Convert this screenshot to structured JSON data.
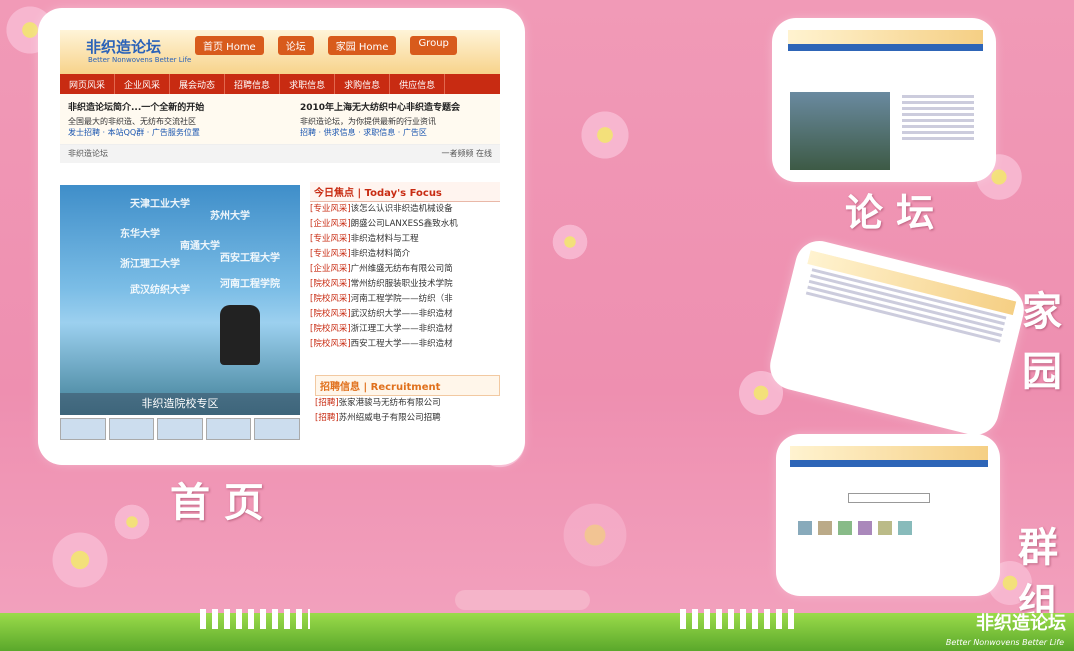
{
  "home": {
    "logo": "非织造论坛",
    "logo_sub": "Better Nonwovens Better Life",
    "top_tabs": [
      "首页\nHome",
      "论坛",
      "家园\nHome",
      "Group"
    ],
    "nav": [
      "网页风采",
      "企业风采",
      "展会动态",
      "招聘信息",
      "求职信息",
      "求购信息",
      "供应信息"
    ],
    "news_left_title": "非织造论坛简介...一个全新的开始",
    "news_left_desc": "全国最大的非织造、无纺布交流社区",
    "news_left_links": "发士招聘 · 本站QQ群 · 广告服务位置",
    "news_right_title": "2010年上海无大纺织中心非织造专题会",
    "news_right_desc": "非织造论坛，为你提供最新的行业资讯",
    "news_right_links": "招聘 · 供求信息 · 求职信息 · 广告区",
    "breadcrumb": "非织造论坛",
    "breadcrumb_right": "一者频频  在线",
    "banner_unis": [
      "天津工业大学",
      "苏州大学",
      "东华大学",
      "南通大学",
      "浙江理工大学",
      "西安工程大学",
      "武汉纺织大学",
      "河南工程学院"
    ],
    "banner_zone": "非织造院校专区",
    "focus_title": "今日焦点 | Today's Focus",
    "focus_items": [
      {
        "tag": "[专业风采]",
        "text": "该怎么认识非织造机械设备"
      },
      {
        "tag": "[企业风采]",
        "text": "朗盛公司LANXESS鑫致水机"
      },
      {
        "tag": "[专业风采]",
        "text": "非织造材料与工程"
      },
      {
        "tag": "[专业风采]",
        "text": "非织造材料简介"
      },
      {
        "tag": "[企业风采]",
        "text": "广州维盛无纺布有限公司简"
      },
      {
        "tag": "[院校风采]",
        "text": "常州纺织服装职业技术学院"
      },
      {
        "tag": "[院校风采]",
        "text": "河南工程学院——纺织（非"
      },
      {
        "tag": "[院校风采]",
        "text": "武汉纺织大学——非织造材"
      },
      {
        "tag": "[院校风采]",
        "text": "浙江理工大学——非织造材"
      },
      {
        "tag": "[院校风采]",
        "text": "西安工程大学——非织造材"
      }
    ],
    "recruit_title": "招聘信息 | Recruitment",
    "recruit_items": [
      {
        "tag": "[招聘]",
        "text": "张家港骏马无纺布有限公司"
      },
      {
        "tag": "[招聘]",
        "text": "苏州绍威电子有限公司招聘"
      }
    ]
  },
  "captions": {
    "home": "首 页",
    "forum": "论 坛",
    "family": "家园",
    "group": "群组"
  },
  "brand": {
    "name": "非织造论坛",
    "slogan": "Better Nonwovens Better Life"
  }
}
